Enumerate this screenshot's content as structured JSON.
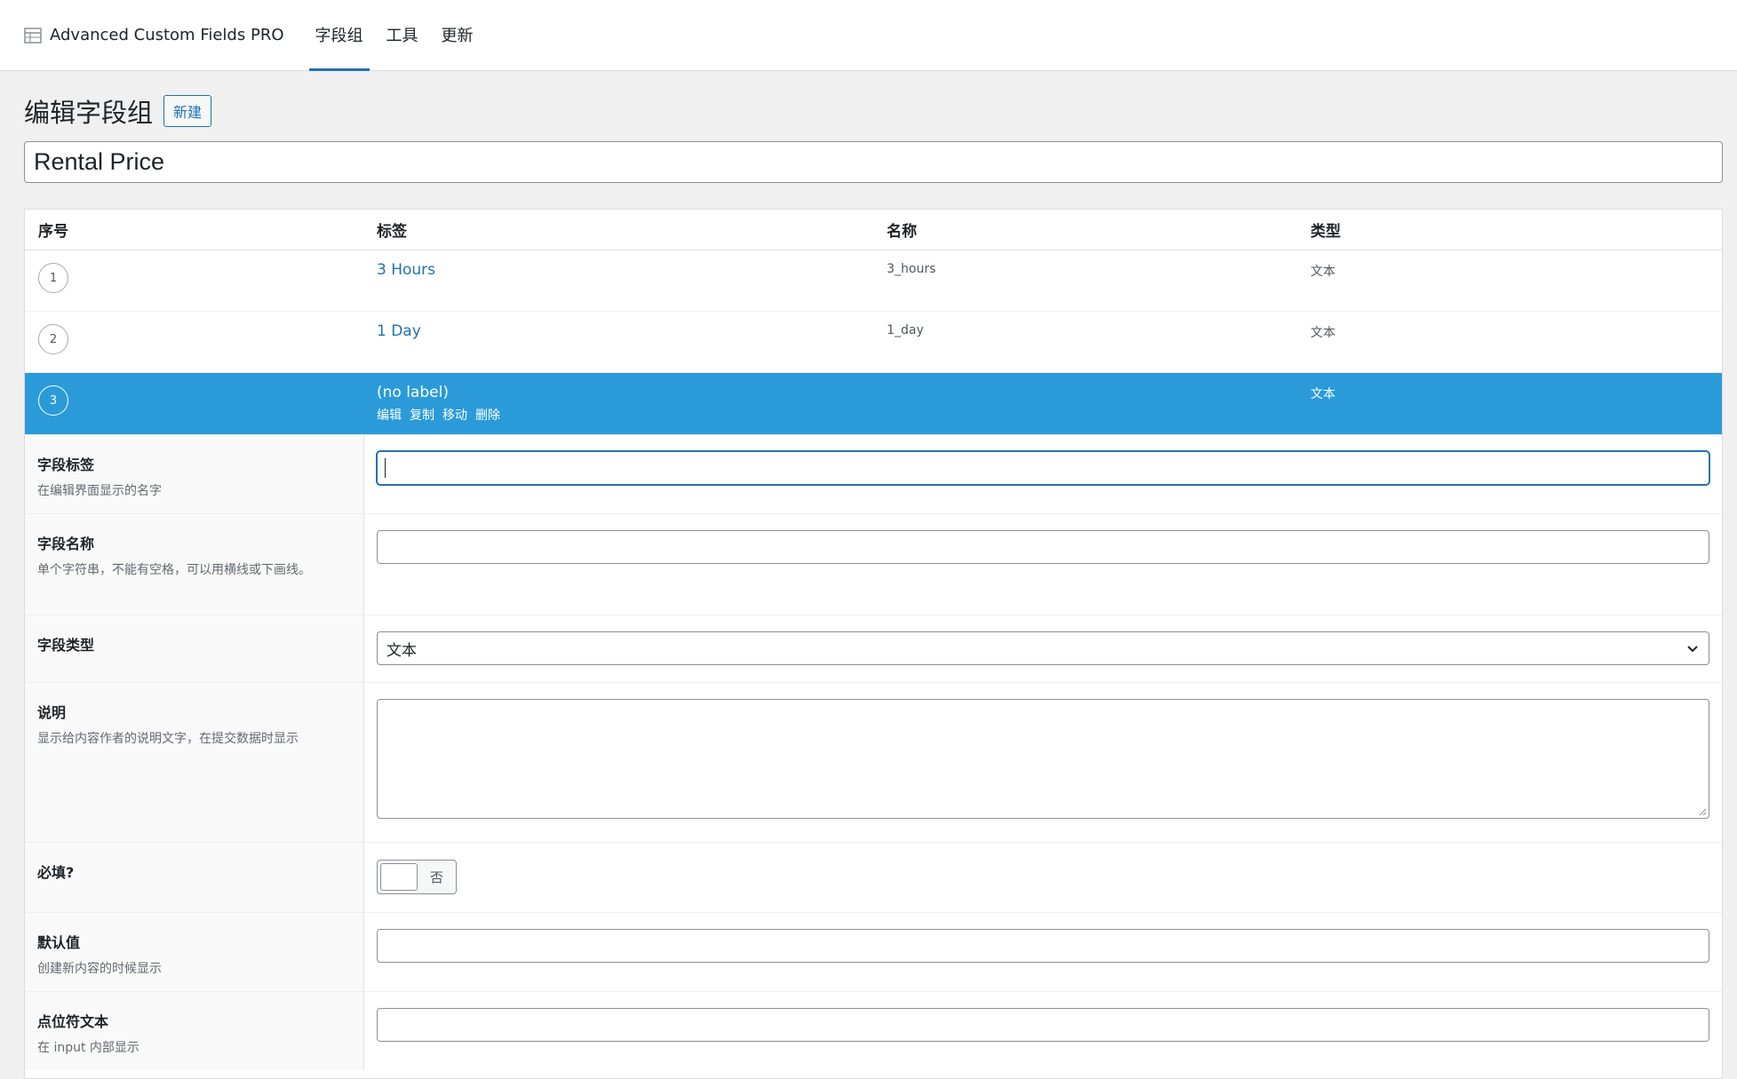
{
  "nav": {
    "brand": "Advanced Custom Fields PRO",
    "tabs": [
      {
        "label": "字段组",
        "active": true
      },
      {
        "label": "工具",
        "active": false
      },
      {
        "label": "更新",
        "active": false
      }
    ]
  },
  "page": {
    "title": "编辑字段组",
    "new_button": "新建",
    "group_title": "Rental Price"
  },
  "list": {
    "headers": {
      "order": "序号",
      "label": "标签",
      "name": "名称",
      "type": "类型"
    },
    "rows": [
      {
        "order": "1",
        "label": "3 Hours",
        "name": "3_hours",
        "type": "文本"
      },
      {
        "order": "2",
        "label": "1 Day",
        "name": "1_day",
        "type": "文本"
      },
      {
        "order": "3",
        "label": "(no label)",
        "name": "",
        "type": "文本",
        "actions": [
          "编辑",
          "复制",
          "移动",
          "删除"
        ]
      }
    ]
  },
  "settings": {
    "field_label": {
      "title": "字段标签",
      "desc": "在编辑界面显示的名字",
      "value": ""
    },
    "field_name": {
      "title": "字段名称",
      "desc": "单个字符串，不能有空格，可以用横线或下画线。",
      "value": ""
    },
    "field_type": {
      "title": "字段类型",
      "value": "文本"
    },
    "instructions": {
      "title": "说明",
      "desc": "显示给内容作者的说明文字，在提交数据时显示",
      "value": ""
    },
    "required": {
      "title": "必填?",
      "toggle_label": "否"
    },
    "default_value": {
      "title": "默认值",
      "desc": "创建新内容的时候显示",
      "value": ""
    },
    "placeholder": {
      "title": "点位符文本",
      "desc": "在 input 内部显示",
      "value": ""
    }
  },
  "colors": {
    "accent": "#2271b1",
    "selected_row": "#2a9bd8"
  }
}
